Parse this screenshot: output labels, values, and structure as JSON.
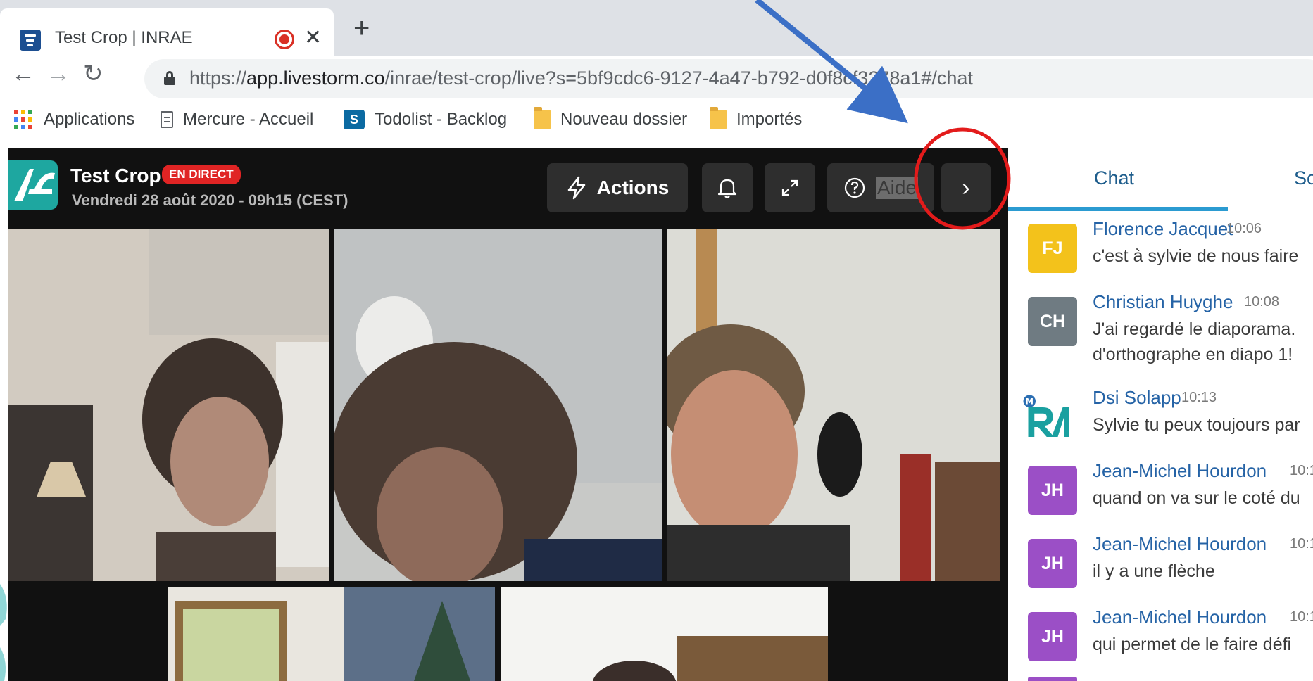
{
  "browser": {
    "tab": {
      "title": "Test Crop | INRAE",
      "close": "✕"
    },
    "new_tab": "+",
    "nav": {
      "back": "←",
      "forward": "→",
      "reload": "↻"
    },
    "url": {
      "scheme": "https://",
      "host": "app.livestorm.co",
      "path": "/inrae/test-crop/live?s=5bf9cdc6-9127-4a47-b792-d0f8cf3278a1#/chat"
    },
    "bookmarks": [
      {
        "label": "Applications",
        "icon": "apps-grid-icon"
      },
      {
        "label": "Mercure - Accueil",
        "icon": "document-icon"
      },
      {
        "label": "Todolist - Backlog",
        "icon": "sharepoint-icon"
      },
      {
        "label": "Nouveau dossier",
        "icon": "folder-icon"
      },
      {
        "label": "Importés",
        "icon": "folder-icon"
      }
    ]
  },
  "event": {
    "title": "Test Crop",
    "live_badge": "EN DIRECT",
    "date": "Vendredi 28 août 2020 - 09h15 (CEST)",
    "buttons": {
      "actions": "Actions",
      "notifications_icon": "bell-icon",
      "fullscreen_icon": "expand-icon",
      "help": "Aide",
      "toggle_panel": "›"
    }
  },
  "chat": {
    "tabs": [
      "Chat",
      "Sc"
    ],
    "messages": [
      {
        "initials": "FJ",
        "color": "#f3c21b",
        "author": "Florence Jacquet",
        "time": "10:06",
        "lines": [
          "c'est à sylvie de nous faire"
        ]
      },
      {
        "initials": "CH",
        "color": "#6f7b82",
        "author": "Christian Huyghe",
        "time": "10:08",
        "lines": [
          "J'ai regardé le diaporama.",
          "d'orthographe en diapo 1!"
        ]
      },
      {
        "initials": "",
        "color": "#ffffff",
        "author": "Dsi Solapp",
        "time": "10:13",
        "lines": [
          "Sylvie tu peux toujours par"
        ]
      },
      {
        "initials": "JH",
        "color": "#9b4fc6",
        "author": "Jean-Michel Hourdon",
        "time": "10:1",
        "lines": [
          "quand on va sur le coté du"
        ]
      },
      {
        "initials": "JH",
        "color": "#9b4fc6",
        "author": "Jean-Michel Hourdon",
        "time": "10:1",
        "lines": [
          "il y a une flèche"
        ]
      },
      {
        "initials": "JH",
        "color": "#9b4fc6",
        "author": "Jean-Michel Hourdon",
        "time": "10:1",
        "lines": [
          "qui permet de le faire défi"
        ]
      }
    ]
  },
  "colors": {
    "accent": "#2b9bd1",
    "live_red": "#e02424",
    "annotation_arrow": "#3b6fc6",
    "annotation_circle": "#e31b1b"
  }
}
